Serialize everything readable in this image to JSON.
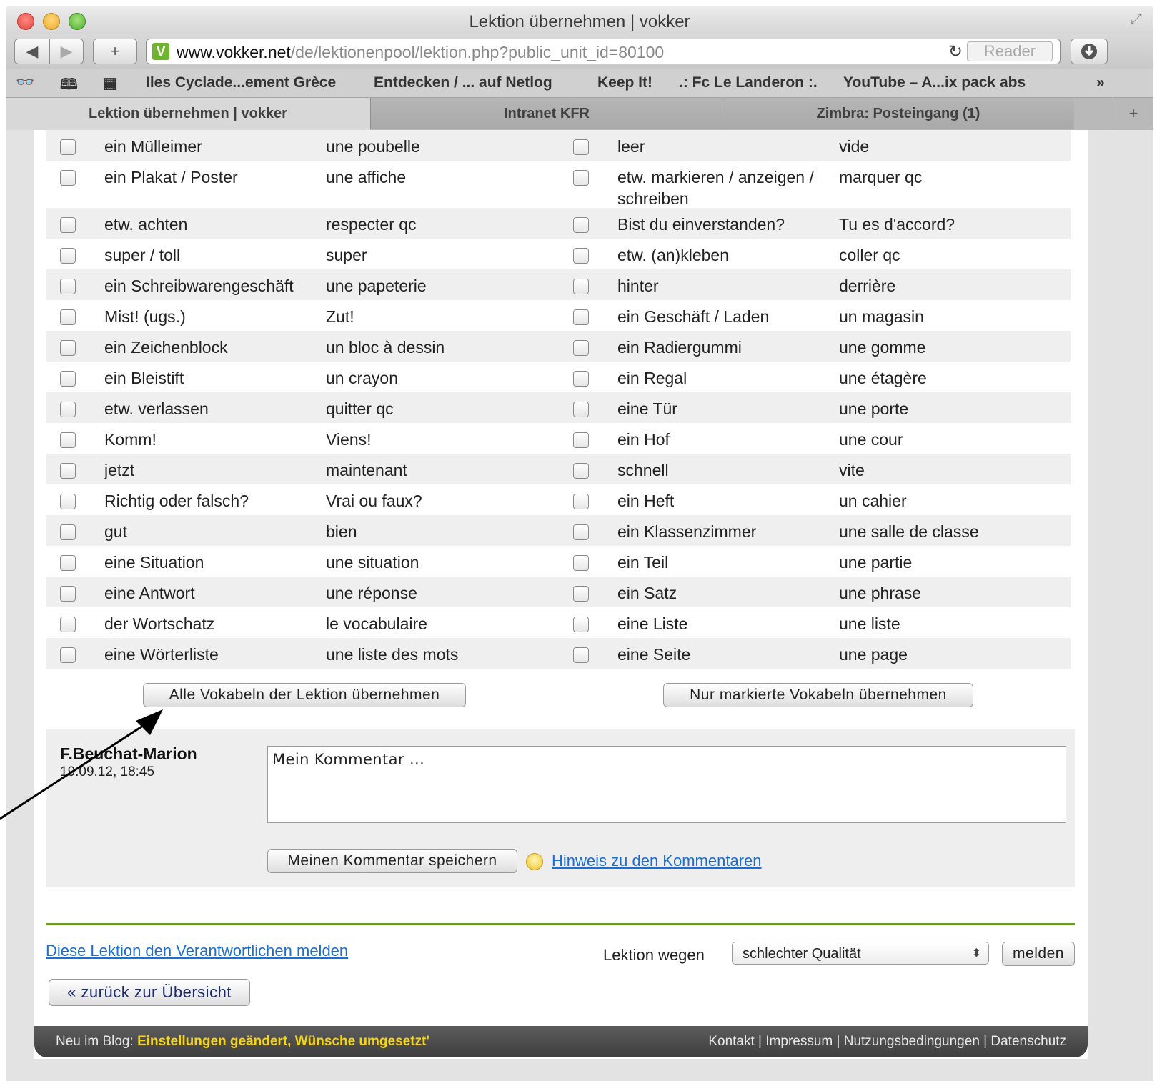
{
  "window": {
    "title": "Lektion übernehmen | vokker"
  },
  "toolbar": {
    "back": "◀",
    "forward": "▶",
    "add": "+",
    "url_domain": "www.vokker.net",
    "url_path": "/de/lektionenpool/lektion.php?public_unit_id=80100",
    "reload": "↻",
    "reader": "Reader"
  },
  "bookmarks": [
    "Iles Cyclade...ement Grèce",
    "Entdecken / ... auf Netlog",
    "Keep It!",
    ".: Fc Le Landeron :.",
    "YouTube – A...ix pack abs"
  ],
  "tabs": [
    {
      "label": "Lektion übernehmen | vokker"
    },
    {
      "label": "Intranet KFR"
    },
    {
      "label": "Zimbra: Posteingang (1)"
    }
  ],
  "vocab": [
    {
      "de1": "ein Mülleimer",
      "fr1": "une poubelle",
      "de2": "leer",
      "fr2": "vide"
    },
    {
      "de1": "ein Plakat / Poster",
      "fr1": "une affiche",
      "de2": "etw. markieren / anzeigen / schreiben",
      "fr2": "marquer qc"
    },
    {
      "de1": "etw. achten",
      "fr1": "respecter qc",
      "de2": "Bist du einverstanden?",
      "fr2": "Tu es d'accord?"
    },
    {
      "de1": "super / toll",
      "fr1": "super",
      "de2": "etw. (an)kleben",
      "fr2": "coller qc"
    },
    {
      "de1": "ein Schreibwarengeschäft",
      "fr1": "une papeterie",
      "de2": "hinter",
      "fr2": "derrière"
    },
    {
      "de1": "Mist! (ugs.)",
      "fr1": "Zut!",
      "de2": "ein Geschäft / Laden",
      "fr2": "un magasin"
    },
    {
      "de1": "ein Zeichenblock",
      "fr1": "un bloc à dessin",
      "de2": "ein Radiergummi",
      "fr2": "une gomme"
    },
    {
      "de1": "ein Bleistift",
      "fr1": "un crayon",
      "de2": "ein Regal",
      "fr2": "une étagère"
    },
    {
      "de1": "etw. verlassen",
      "fr1": "quitter qc",
      "de2": "eine Tür",
      "fr2": "une porte"
    },
    {
      "de1": "Komm!",
      "fr1": "Viens!",
      "de2": "ein Hof",
      "fr2": "une cour"
    },
    {
      "de1": "jetzt",
      "fr1": "maintenant",
      "de2": "schnell",
      "fr2": "vite"
    },
    {
      "de1": "Richtig oder falsch?",
      "fr1": "Vrai ou faux?",
      "de2": "ein Heft",
      "fr2": "un cahier"
    },
    {
      "de1": "gut",
      "fr1": "bien",
      "de2": "ein Klassenzimmer",
      "fr2": "une salle de classe"
    },
    {
      "de1": "eine Situation",
      "fr1": "une situation",
      "de2": "ein Teil",
      "fr2": "une partie"
    },
    {
      "de1": "eine Antwort",
      "fr1": "une réponse",
      "de2": "ein Satz",
      "fr2": "une phrase"
    },
    {
      "de1": "der Wortschatz",
      "fr1": "le vocabulaire",
      "de2": "eine Liste",
      "fr2": "une liste"
    },
    {
      "de1": "eine Wörterliste",
      "fr1": "une liste des mots",
      "de2": "eine Seite",
      "fr2": "une page"
    }
  ],
  "buttons": {
    "take_all": "Alle Vokabeln der Lektion übernehmen",
    "take_marked": "Nur markierte Vokabeln übernehmen"
  },
  "comment": {
    "author": "F.Beuchat-Marion",
    "date": "19.09.12, 18:45",
    "text": "Mein Kommentar ...",
    "save_button": "Meinen Kommentar speichern",
    "hint_link": "Hinweis zu den Kommentaren"
  },
  "report": {
    "link": "Diese Lektion den Verantwortlichen melden",
    "label": "Lektion wegen",
    "reason_selected": "schlechter Qualität",
    "submit": "melden"
  },
  "back_link": "« zurück zur Übersicht",
  "footer": {
    "blog_prefix": "Neu im Blog:",
    "blog_title": "Einstellungen geändert, Wünsche umgesetzt'",
    "links": "Kontakt | Impressum | Nutzungsbedingungen | Datenschutz"
  }
}
